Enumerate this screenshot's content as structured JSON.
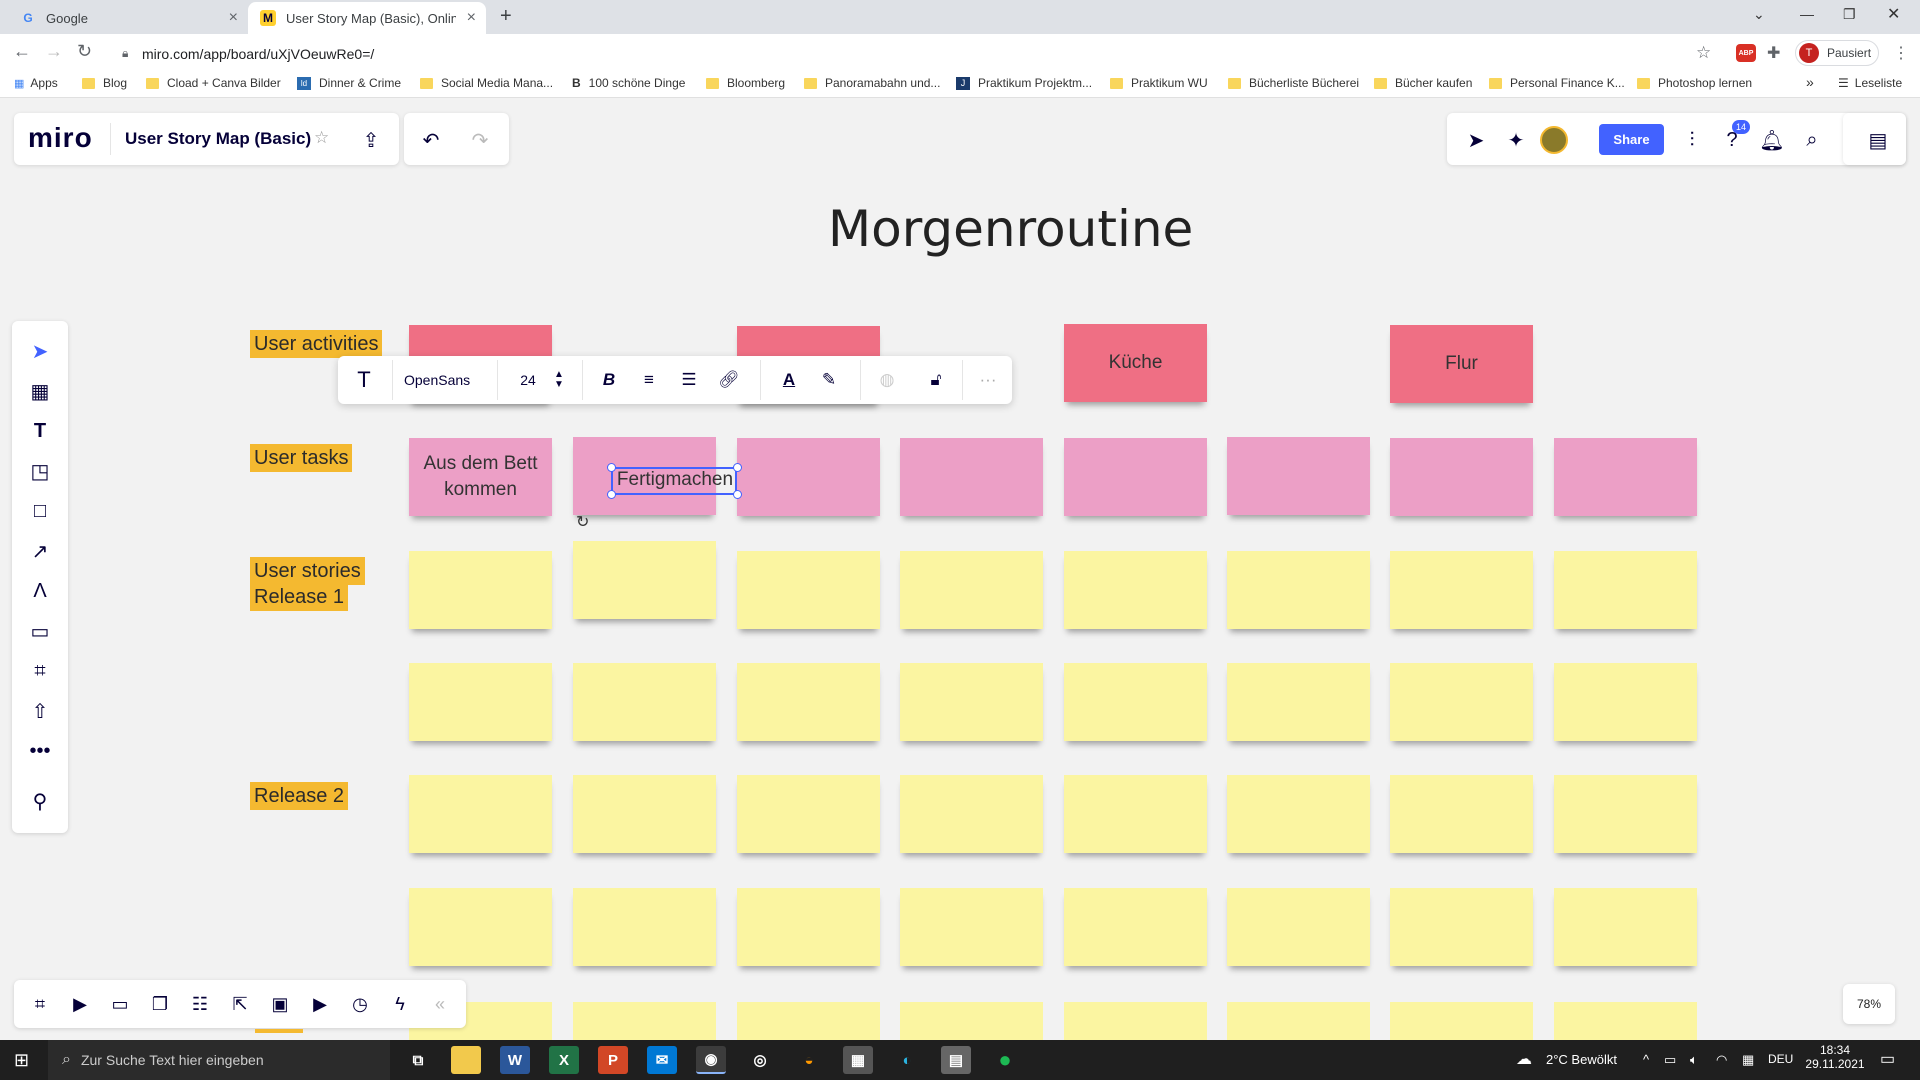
{
  "browser": {
    "tabs": [
      {
        "label": "Google",
        "icon": "G"
      },
      {
        "label": "User Story Map (Basic), Online W",
        "icon": "M"
      }
    ],
    "new_tab": "+",
    "url": "miro.com/app/board/uXjVOeuwRe0=/",
    "profile_status": "Pausiert",
    "profile_initial": "T",
    "extension_badge": "ABP",
    "bookmarks": [
      "Apps",
      "Blog",
      "Cload + Canva Bilder",
      "Dinner & Crime",
      "Social Media Mana...",
      "100 schöne Dinge",
      "Bloomberg",
      "Panoramabahn und...",
      "Praktikum Projektm...",
      "Praktikum WU",
      "Bücherliste Bücherei",
      "Bücher kaufen",
      "Personal Finance K...",
      "Photoshop lernen"
    ],
    "bookmark_overflow": "»",
    "reading_list": "Leseliste"
  },
  "miro": {
    "logo": "miro",
    "board_name": "User Story Map (Basic)",
    "share_label": "Share",
    "help_badge": "14",
    "zoom": "78%"
  },
  "board": {
    "title": "Morgenroutine",
    "row_labels": {
      "activities": "User activities",
      "tasks": "User tasks",
      "stories_line1": "User stories",
      "stories_line2": "Release 1",
      "release2": "Release 2"
    },
    "activity_notes": [
      "",
      "",
      "Küche",
      "Flur"
    ],
    "task_notes": [
      "Aus dem Bett kommen",
      "Fertigmachen",
      "",
      "",
      "",
      "",
      "",
      ""
    ]
  },
  "text_toolbar": {
    "font": "OpenSans",
    "size": "24"
  },
  "taskbar": {
    "search_placeholder": "Zur Suche Text hier eingeben",
    "weather": "2°C  Bewölkt",
    "lang": "DEU",
    "time": "18:34",
    "date": "29.11.2021"
  },
  "colors": {
    "accent": "#4262ff",
    "activity_note": "#ef6f84",
    "task_note": "#ec9fc6",
    "story_note": "#fbf5a1",
    "row_label": "#f4b930"
  }
}
